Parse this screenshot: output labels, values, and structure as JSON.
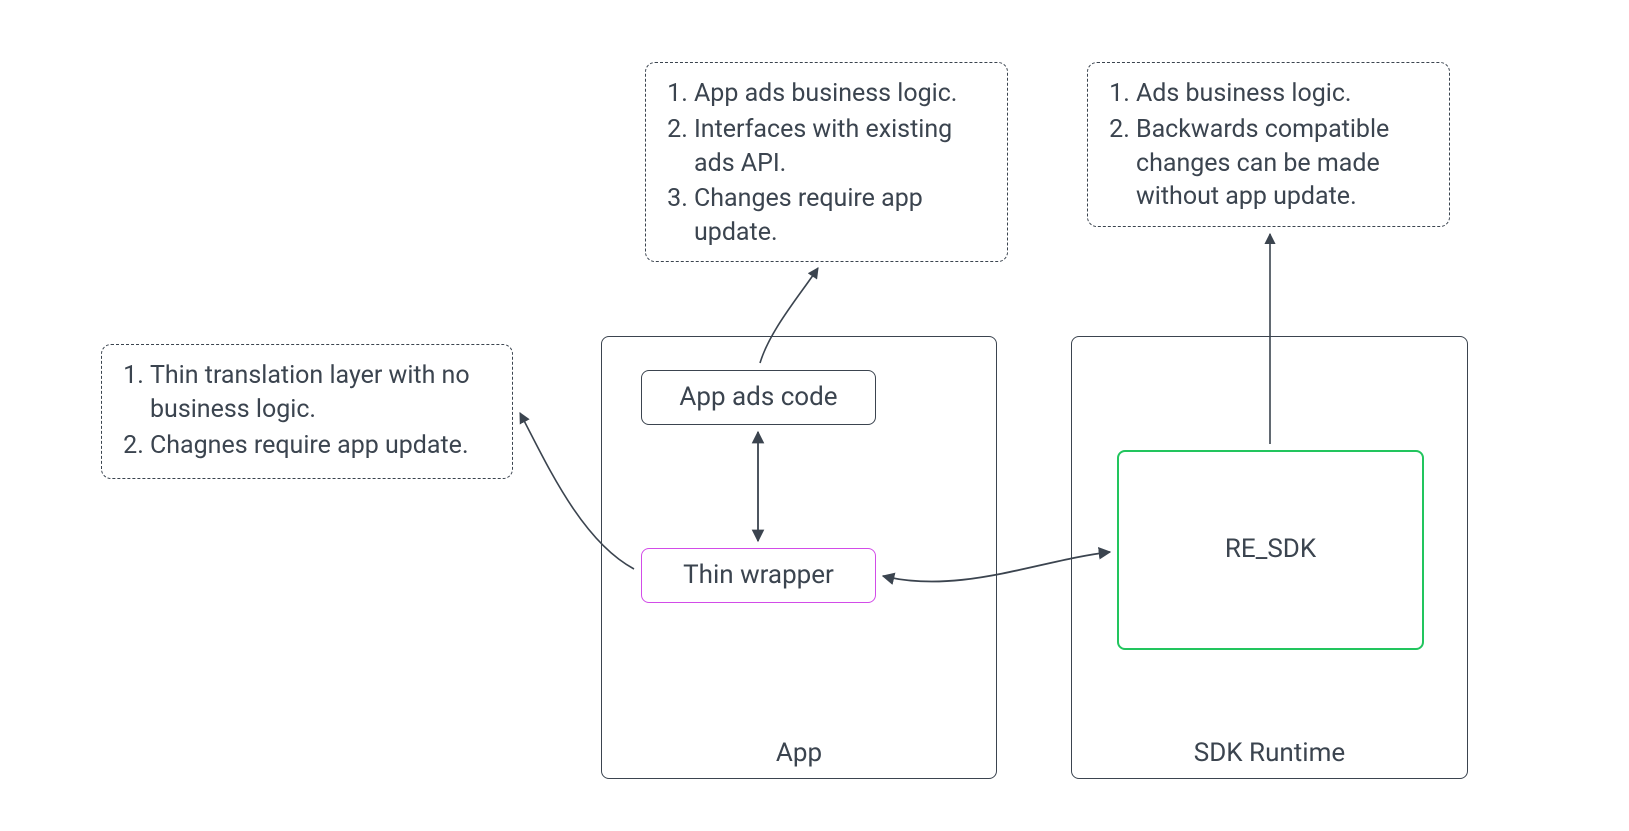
{
  "containers": {
    "app": {
      "label": "App"
    },
    "sdk_runtime": {
      "label": "SDK Runtime"
    }
  },
  "nodes": {
    "app_ads_code": {
      "label": "App ads code"
    },
    "thin_wrapper": {
      "label": "Thin wrapper"
    },
    "re_sdk": {
      "label": "RE_SDK"
    }
  },
  "notes": {
    "left": {
      "items": [
        "Thin translation layer with no business logic.",
        "Chagnes require app update."
      ]
    },
    "top_mid": {
      "items": [
        "App ads business logic.",
        "Interfaces with existing ads API.",
        "Changes require app update."
      ]
    },
    "top_right": {
      "items": [
        "Ads business logic.",
        "Backwards compatible changes can be made without app update."
      ]
    }
  }
}
